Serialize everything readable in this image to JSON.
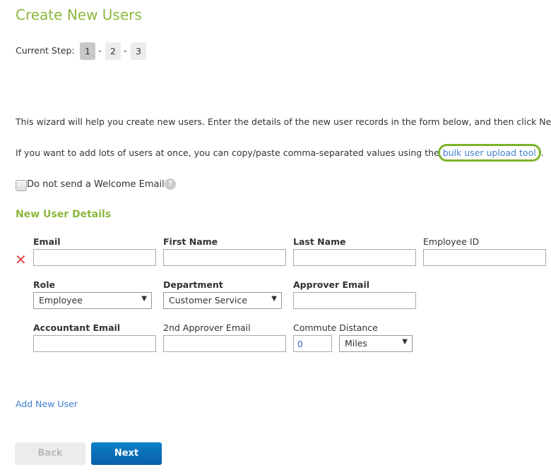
{
  "title": "Create New Users",
  "steps": {
    "label": "Current Step:",
    "items": [
      "1",
      "2",
      "3"
    ],
    "current": "1",
    "sep": "-"
  },
  "intro": {
    "line1": "This wizard will help you create new users. Enter the details of the new user records in the form below, and then click Next.",
    "line2_prefix": "If you want to add lots of users at once, you can copy/paste comma-separated values using the ",
    "line2_link": "bulk user upload tool",
    "line2_suffix": "."
  },
  "welcome": {
    "label": "Do not send a Welcome Email",
    "checked": false,
    "help": "?"
  },
  "section": "New User Details",
  "fields": {
    "email": "Email",
    "first_name": "First Name",
    "last_name": "Last Name",
    "employee_id": "Employee ID",
    "role": "Role",
    "role_value": "Employee",
    "department": "Department",
    "department_value": "Customer Service",
    "approver_email": "Approver Email",
    "accountant_email": "Accountant Email",
    "approver2_email": "2nd Approver Email",
    "commute": "Commute Distance",
    "commute_value": "0",
    "commute_unit": "Miles"
  },
  "add_user": "Add New User",
  "buttons": {
    "back": "Back",
    "next": "Next"
  },
  "colors": {
    "accent": "#8cb83e",
    "link": "#3f7fcf",
    "primary": "#0a6fbb",
    "remove": "#e64545"
  }
}
